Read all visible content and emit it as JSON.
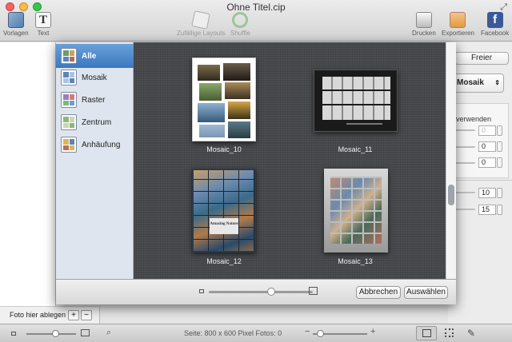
{
  "window": {
    "title": "Ohne Titel.cip"
  },
  "toolbar": {
    "vorlagen": "Vorlagen",
    "text": "Text",
    "zufaellige_layouts": "Zufällige Layouts",
    "shuffle": "Shuffle",
    "drucken": "Drucken",
    "exportieren": "Exportieren",
    "facebook": "Facebook"
  },
  "right_panel": {
    "freier": "Freier",
    "layout_select": "Mosaik",
    "verwenden": "verwenden",
    "fields": [
      "0",
      "0",
      "0",
      "10",
      "15"
    ]
  },
  "dialog": {
    "categories": [
      {
        "label": "Alle",
        "icon": "all-templates-icon",
        "selected": true
      },
      {
        "label": "Mosaik",
        "icon": "mosaic-icon",
        "selected": false
      },
      {
        "label": "Raster",
        "icon": "grid-icon",
        "selected": false
      },
      {
        "label": "Zentrum",
        "icon": "center-icon",
        "selected": false
      },
      {
        "label": "Anhäufung",
        "icon": "pile-icon",
        "selected": false
      }
    ],
    "templates": [
      {
        "name": "Mosaic_10"
      },
      {
        "name": "Mosaic_11"
      },
      {
        "name": "Mosaic_12",
        "text": "Amazing Nature"
      },
      {
        "name": "Mosaic_13"
      }
    ],
    "zoom_level": 0.6,
    "cancel": "Abbrechen",
    "select": "Auswählen"
  },
  "left_panel": {
    "drop_label": "Foto hier ablegen",
    "plus": "+",
    "minus": "−"
  },
  "statusbar": {
    "info": "Seite: 800 x 600 Pixel Fotos: 0",
    "plus": "+",
    "minus": "−",
    "photo_zoom": 0.6,
    "page_zoom": 0.15
  },
  "colors": {
    "close": "#fc605c",
    "minimize": "#fdbc40",
    "zoom": "#34c84a",
    "selection": "#3b78c0",
    "canvas": "#46484c"
  }
}
